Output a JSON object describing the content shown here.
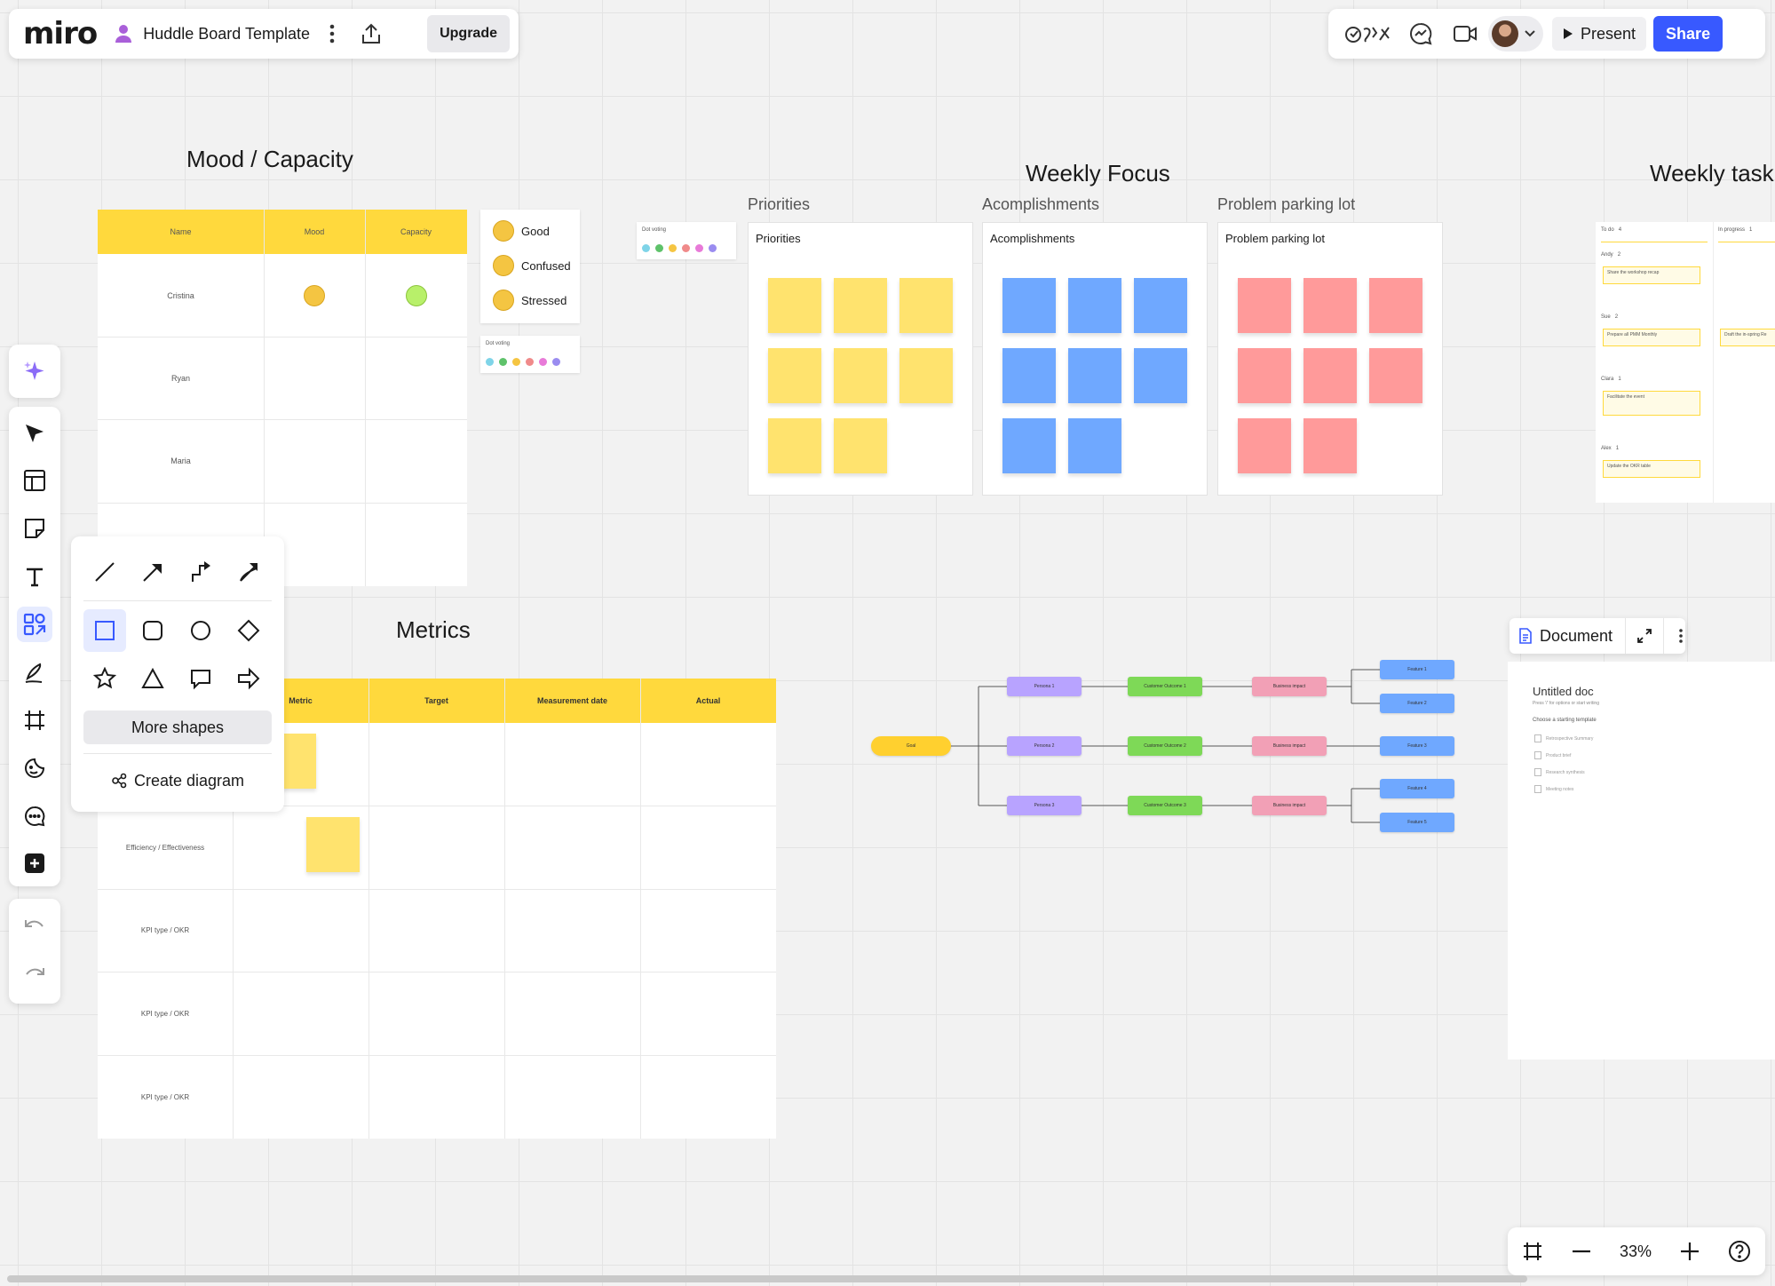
{
  "app": {
    "logo": "miro",
    "board_title": "Huddle Board Template",
    "upgrade_label": "Upgrade"
  },
  "header_right": {
    "present_label": "Present",
    "share_label": "Share"
  },
  "mood": {
    "title": "Mood / Capacity",
    "headers": [
      "Name",
      "Mood",
      "Capacity"
    ],
    "rows": [
      "Cristina",
      "Ryan",
      "Maria",
      ""
    ],
    "legend": [
      "Good",
      "Confused",
      "Stressed"
    ],
    "dot_voting_label": "Dot voting",
    "dot_colors": [
      "#7fd4e8",
      "#5ec26a",
      "#f5c542",
      "#f08a8a",
      "#e87ad8",
      "#9a8cf0"
    ]
  },
  "weekly_focus": {
    "title": "Weekly Focus",
    "frames": [
      {
        "label": "Priorities",
        "inner": "Priorities",
        "color": "#ffe36e",
        "count": 8
      },
      {
        "label": "Acomplishments",
        "inner": "Acomplishments",
        "color": "#6fa8ff",
        "count": 8
      },
      {
        "label": "Problem parking lot",
        "inner": "Problem parking lot",
        "color": "#ff9a9a",
        "count": 8
      }
    ]
  },
  "weekly_tasks": {
    "title": "Weekly task",
    "col1": "To do",
    "col1_count": "4",
    "col2": "In progress",
    "col2_count": "1",
    "people": [
      {
        "name": "Andy",
        "count": "2",
        "task": "Share the workshop recap"
      },
      {
        "name": "Sue",
        "count": "2",
        "task": "Prepare all PMM Monthly"
      },
      {
        "name": "Clara",
        "count": "1",
        "task": "Facilitate the event"
      },
      {
        "name": "Alex",
        "count": "1",
        "task": "Update the OKR table"
      }
    ],
    "in_progress_task": "Draft the in-spring Re"
  },
  "metrics": {
    "title": "Metrics",
    "headers": [
      "Metric",
      "Target",
      "Measurement date",
      "Actual"
    ],
    "row_labels": [
      "",
      "Efficiency / Effectiveness",
      "KPI type / OKR",
      "KPI type / OKR",
      "KPI type / OKR"
    ]
  },
  "shapes_panel": {
    "more_shapes": "More shapes",
    "create_diagram": "Create diagram"
  },
  "tree": {
    "goal": "Goal",
    "personas": [
      "Persona 1",
      "Persona 2",
      "Persona 3"
    ],
    "outcomes": [
      "Customer Outcome 1",
      "Customer Outcome 2",
      "Customer Outcome 3"
    ],
    "impacts": [
      "Business impact",
      "Business impact",
      "Business impact"
    ],
    "features": [
      "Feature 1",
      "Feature 2",
      "Feature 3",
      "Feature 4",
      "Feature 5"
    ]
  },
  "document": {
    "label": "Document",
    "title": "Untitled doc",
    "hint": "Press '/' for options or start writing",
    "choose": "Choose a starting template",
    "templates": [
      "Retrospective Summary",
      "Product brief",
      "Research synthesis",
      "Meeting notes"
    ]
  },
  "zoom": {
    "level": "33%"
  }
}
